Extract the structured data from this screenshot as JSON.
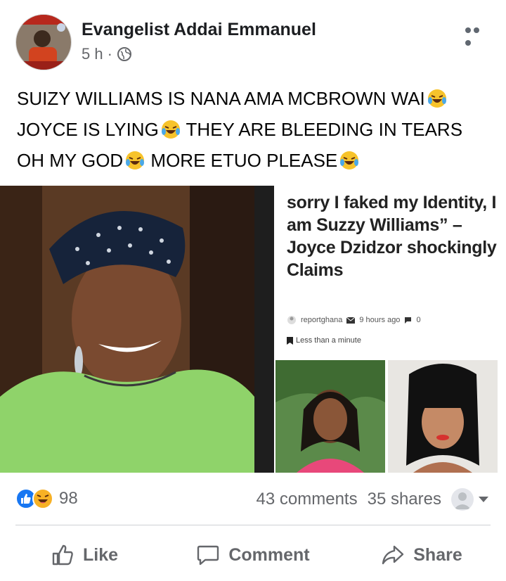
{
  "post": {
    "author": "Evangelist Addai Emmanuel",
    "time": "5 h",
    "separator": "·",
    "text_lines": [
      "SUIZY WILLIAMS IS NANA AMA MCBROWN WAI",
      "JOYCE IS LYING",
      " THEY ARE BLEEDING IN TEARS",
      "OH MY GOD",
      " MORE ETUO PLEASE"
    ]
  },
  "article": {
    "title": "sorry I faked my Identity, I am Suzzy Williams” – Joyce Dzidzor shockingly Claims",
    "source": "reportghana",
    "time_ago": "9 hours ago",
    "comments": "0",
    "read_time": "Less than a minute"
  },
  "engagement": {
    "reaction_count": "98",
    "comments": "43 comments",
    "shares": "35 shares"
  },
  "actions": {
    "like": "Like",
    "comment": "Comment",
    "share": "Share"
  },
  "colors": {
    "like_blue": "#1877f2",
    "haha_yellow": "#f7b125",
    "muted_text": "#65676b"
  },
  "icons": [
    "globe-icon",
    "more-icon",
    "like-reaction-icon",
    "haha-reaction-icon",
    "like-icon",
    "comment-icon",
    "share-icon"
  ]
}
